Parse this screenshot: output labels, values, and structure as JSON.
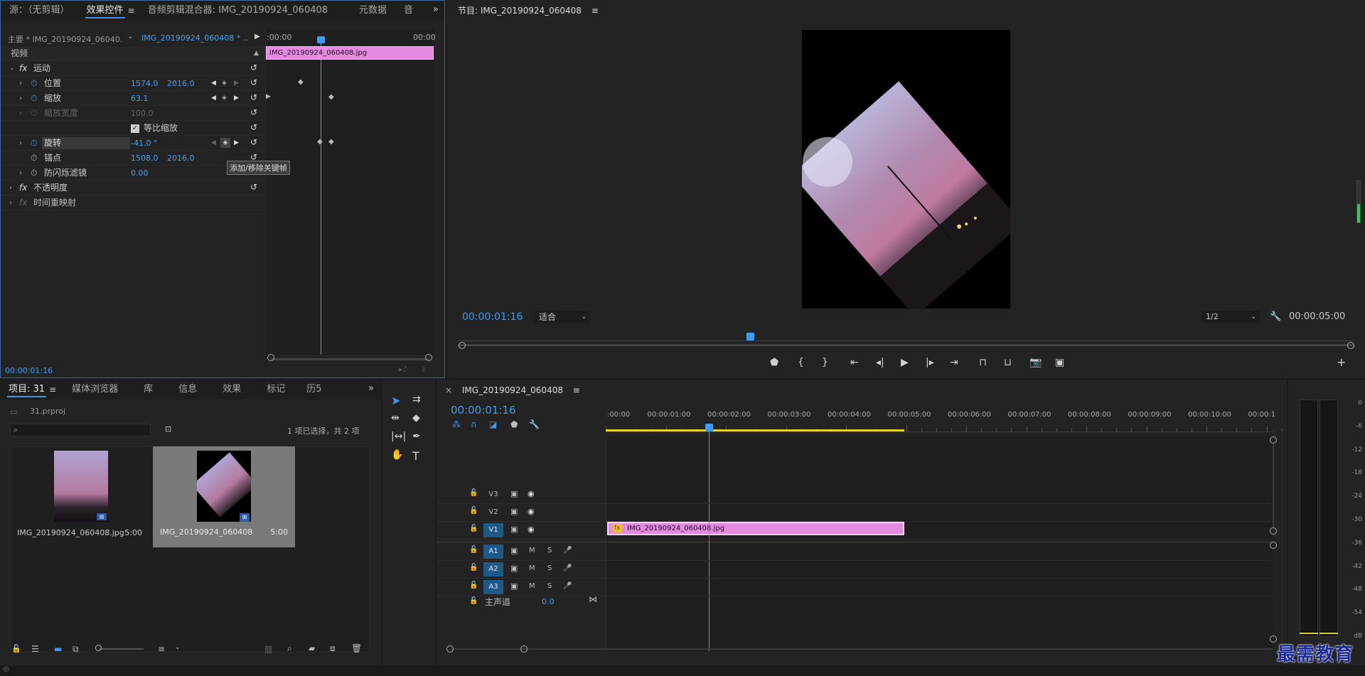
{
  "source_panel": {
    "tabs": [
      "源：（无剪辑）",
      "效果控件",
      "音频剪辑混合器: IMG_20190924_060408",
      "元数据",
      "音"
    ],
    "active_tab": "效果控件",
    "master_label": "主要 * IMG_20190924_06040...",
    "clip_dropdown": "IMG_20190924_060408 * ...",
    "ruler_start": ":00:00",
    "ruler_end": "00:00",
    "clip_bar_label": "IMG_20190924_060408.jpg",
    "section_video": "视频",
    "motion_label": "运动",
    "position_label": "位置",
    "position_x": "1574.0",
    "position_y": "2016.0",
    "scale_label": "缩放",
    "scale_value": "63.1",
    "scale_width_label": "缩放宽度",
    "scale_width_value": "100.0",
    "uniform_scale_label": "等比缩放",
    "rotation_label": "旋转",
    "rotation_value": "-41.0 °",
    "anchor_label": "锚点",
    "anchor_x": "1508.0",
    "anchor_y": "2016.0",
    "anti_flicker_label": "防闪烁滤镜",
    "anti_flicker_value": "0.00",
    "tooltip": "添加/移除关键帧",
    "opacity_label": "不透明度",
    "time_remap_label": "时间重映射",
    "timecode": "00:00:01:16"
  },
  "program_panel": {
    "title": "节目: IMG_20190924_060408",
    "timecode": "00:00:01:16",
    "fit_label": "适合",
    "quality_label": "1/2",
    "duration": "00:00:05:00"
  },
  "project_panel": {
    "tabs": [
      "项目: 31",
      "媒体浏览器",
      "库",
      "信息",
      "效果",
      "标记",
      "历5"
    ],
    "active_tab": "项目: 31",
    "project_file": "31.prproj",
    "search_placeholder": "",
    "selection_info": "1 项已选择，共 2 项",
    "items": [
      {
        "name": "IMG_20190924_060408.jpg",
        "duration": "5:00"
      },
      {
        "name": "IMG_20190924_060408",
        "duration": "5:00"
      }
    ]
  },
  "timeline_panel": {
    "title": "IMG_20190924_060408",
    "timecode": "00:00:01:16",
    "ruler": [
      ":00:00",
      "00:00:01:00",
      "00:00:02:00",
      "00:00:03:00",
      "00:00:04:00",
      "00:00:05:00",
      "00:00:06:00",
      "00:00:07:00",
      "00:00:08:00",
      "00:00:09:00",
      "00:00:10:00",
      "00:00:1"
    ],
    "video_tracks": [
      "V3",
      "V2",
      "V1"
    ],
    "audio_tracks": [
      "A1",
      "A2",
      "A3"
    ],
    "mute_label": "M",
    "solo_label": "S",
    "master_label": "主声道",
    "master_value": "0.0",
    "clip_label": "IMG_20190924_060408.jpg"
  },
  "meter": {
    "labels": [
      "0",
      "-6",
      "-12",
      "-18",
      "-24",
      "-30",
      "-36",
      "-42",
      "-48",
      "-54",
      "dB"
    ]
  },
  "watermark": "最需教育",
  "colors": {
    "accent_blue": "#3f9bf5",
    "clip_pink": "#e28be0",
    "panel_bg": "#232323",
    "track_highlight": "#1f5a86"
  }
}
